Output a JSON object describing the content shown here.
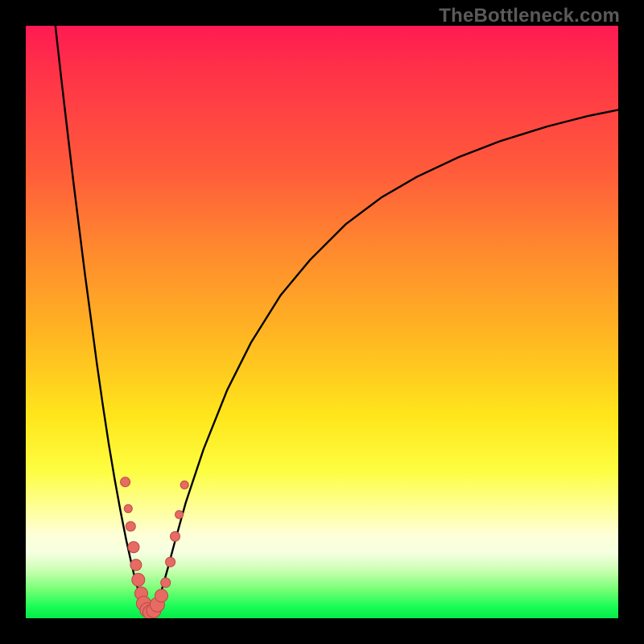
{
  "watermark": "TheBottleneck.com",
  "colors": {
    "frame": "#000000",
    "curve": "#000000",
    "dot_fill": "#e76a63",
    "dot_stroke": "#b94a44",
    "gradient_top": "#ff1a52",
    "gradient_bottom": "#06e94a"
  },
  "chart_data": {
    "type": "line",
    "title": "",
    "xlabel": "",
    "ylabel": "",
    "xlim": [
      0,
      100
    ],
    "ylim": [
      0,
      100
    ],
    "grid": false,
    "annotations": [
      "TheBottleneck.com"
    ],
    "series": [
      {
        "name": "bottleneck-curve",
        "x": [
          5,
          6,
          7,
          8,
          9,
          10,
          11,
          12,
          13,
          14,
          15,
          16,
          17,
          18,
          18.5,
          19,
          19.5,
          20,
          20.5,
          21,
          21.5,
          22,
          22.5,
          23,
          24,
          25,
          27,
          30,
          34,
          38,
          43,
          48,
          54,
          60,
          66,
          73,
          80,
          88,
          95,
          100
        ],
        "y": [
          100,
          91,
          82.5,
          74,
          66,
          58,
          50.5,
          43,
          36,
          29.5,
          23.5,
          18,
          13,
          8.5,
          6.4,
          4.7,
          3.2,
          2.1,
          1.3,
          1.0,
          1.3,
          2.1,
          3.4,
          5.0,
          8.5,
          12.3,
          19.5,
          28.5,
          38.5,
          46.5,
          54.5,
          60.5,
          66.5,
          71.0,
          74.5,
          77.8,
          80.5,
          83.0,
          84.8,
          85.8
        ]
      }
    ],
    "scatter_points": {
      "name": "highlighted-points",
      "points": [
        {
          "x": 16.8,
          "y": 23.0,
          "r": 6
        },
        {
          "x": 17.3,
          "y": 18.5,
          "r": 5
        },
        {
          "x": 17.7,
          "y": 15.5,
          "r": 6
        },
        {
          "x": 18.2,
          "y": 12.0,
          "r": 7
        },
        {
          "x": 18.6,
          "y": 9.0,
          "r": 7
        },
        {
          "x": 19.0,
          "y": 6.5,
          "r": 8
        },
        {
          "x": 19.5,
          "y": 4.2,
          "r": 8
        },
        {
          "x": 19.9,
          "y": 2.5,
          "r": 9
        },
        {
          "x": 20.5,
          "y": 1.4,
          "r": 9
        },
        {
          "x": 21.0,
          "y": 1.0,
          "r": 9
        },
        {
          "x": 21.6,
          "y": 1.3,
          "r": 9
        },
        {
          "x": 22.2,
          "y": 2.3,
          "r": 9
        },
        {
          "x": 22.9,
          "y": 3.8,
          "r": 8
        },
        {
          "x": 23.6,
          "y": 6.0,
          "r": 6
        },
        {
          "x": 24.4,
          "y": 9.5,
          "r": 6
        },
        {
          "x": 25.2,
          "y": 13.8,
          "r": 6
        },
        {
          "x": 25.9,
          "y": 17.5,
          "r": 5
        },
        {
          "x": 26.8,
          "y": 22.5,
          "r": 5
        }
      ]
    }
  }
}
